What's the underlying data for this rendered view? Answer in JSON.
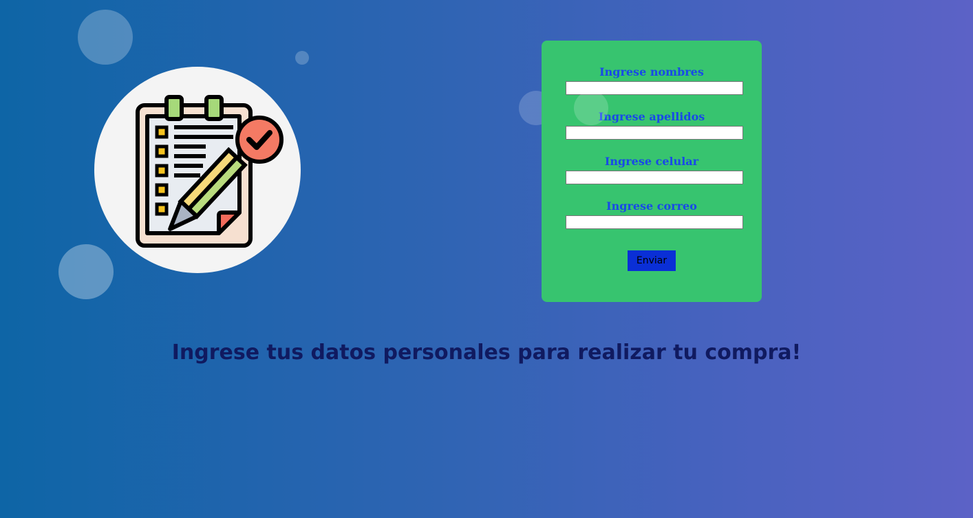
{
  "form": {
    "fields": [
      {
        "label": "Ingrese nombres",
        "value": ""
      },
      {
        "label": "Ingrese apellidos",
        "value": ""
      },
      {
        "label": "Ingrese celular",
        "value": ""
      },
      {
        "label": "Ingrese correo",
        "value": ""
      }
    ],
    "submit_label": "Enviar"
  },
  "headline": "Ingrese tus datos personales para realizar tu compra!",
  "logo": {
    "icon": "checklist-pencil-icon"
  },
  "colors": {
    "background_start": "#0e65a6",
    "background_end": "#5c62c6",
    "card": "#37c46f",
    "label": "#1849e8",
    "button": "#0a2fd6",
    "headline": "#101a60"
  }
}
